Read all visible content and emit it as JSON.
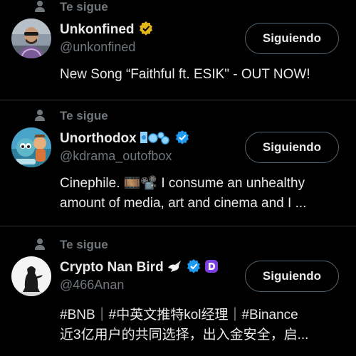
{
  "accounts": [
    {
      "follows_you": "Te sigue",
      "name": "Unkonfined",
      "handle": "@unkonfined",
      "button_label": "Siguiendo",
      "bio_lines": [
        "New Song “Faithful ft. ESIK\" - OUT NOW!"
      ],
      "verified": "gold-checkmark-icon"
    },
    {
      "follows_you": "Te sigue",
      "name": "Unorthodox",
      "handle": "@kdrama_outofbox",
      "button_label": "Siguiendo",
      "bio_lines": [
        "Cinephile. 🎞️📽️ I consume an unhealthy",
        "amount of media, art and cinema and I ..."
      ],
      "verified": "blue-checkmark-icon"
    },
    {
      "follows_you": "Te sigue",
      "name": "Crypto Nan Bird",
      "handle": "@466Anan",
      "button_label": "Siguiendo",
      "bio_lines": [
        "#BNB｜#中英文推特kol经理｜#Binance",
        "近3亿用户的共同选择，出入金安全，启..."
      ],
      "verified": "blue-checkmark-icon"
    }
  ],
  "colors": {
    "background": "#000000",
    "primary_text": "#e7e9ea",
    "secondary_text": "#71767b",
    "divider": "#2f3336",
    "verified_blue": "#1d9bf0",
    "verified_gold": "#e2b719",
    "button_border": "#536471"
  }
}
